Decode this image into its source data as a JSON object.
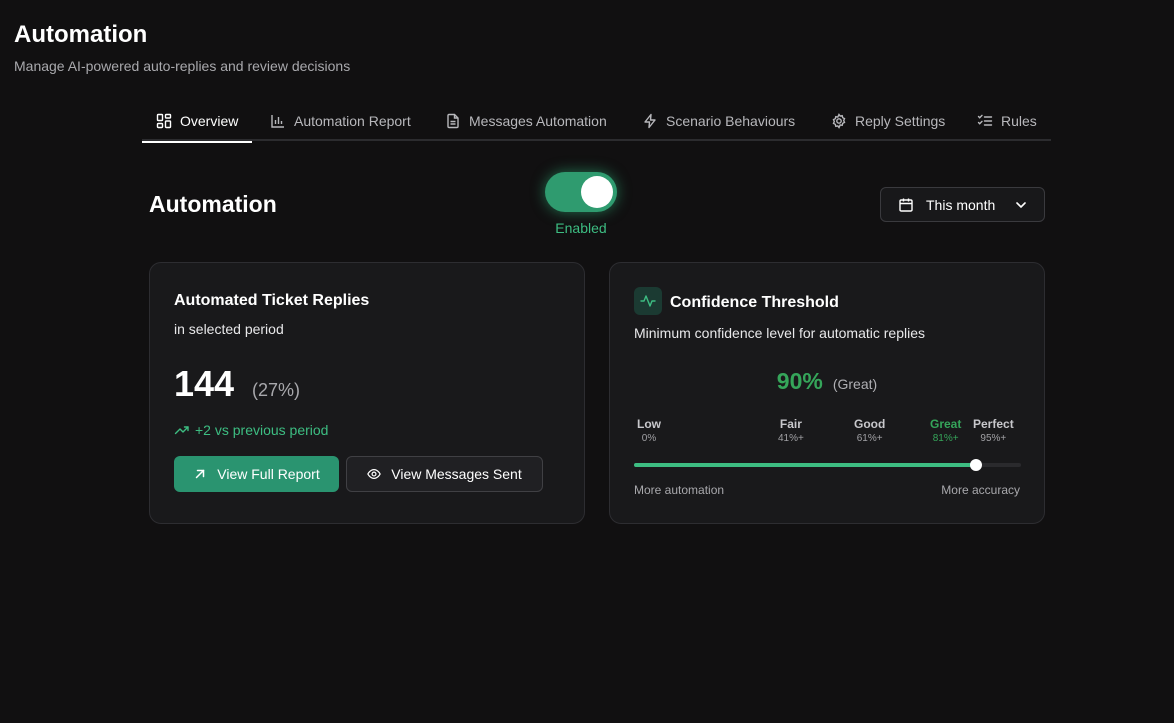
{
  "header": {
    "title": "Automation",
    "subtitle": "Manage AI-powered auto-replies and review decisions"
  },
  "tabs": [
    {
      "label": "Overview",
      "icon": "layout-grid-icon",
      "active": true
    },
    {
      "label": "Automation Report",
      "icon": "bar-chart-icon",
      "active": false
    },
    {
      "label": "Messages Automation",
      "icon": "document-icon",
      "active": false
    },
    {
      "label": "Scenario Behaviours",
      "icon": "lightning-icon",
      "active": false
    },
    {
      "label": "Reply Settings",
      "icon": "gear-icon",
      "active": false
    },
    {
      "label": "Rules",
      "icon": "checklist-icon",
      "active": false
    }
  ],
  "section": {
    "title": "Automation",
    "toggle": {
      "enabled": true,
      "label": "Enabled"
    },
    "period": {
      "label": "This month"
    }
  },
  "replies_card": {
    "title": "Automated Ticket Replies",
    "subtitle": "in selected period",
    "count": "144",
    "percent": "(27%)",
    "trend": "+2 vs previous period",
    "primary_button": "View Full Report",
    "secondary_button": "View Messages Sent"
  },
  "threshold_card": {
    "title": "Confidence Threshold",
    "subtitle": "Minimum confidence level for automatic replies",
    "value": "90%",
    "value_label": "(Great)",
    "slider_fraction": 0.885,
    "levels": [
      {
        "name": "Low",
        "value": "0%"
      },
      {
        "name": "Fair",
        "value": "41%+"
      },
      {
        "name": "Good",
        "value": "61%+"
      },
      {
        "name": "Great",
        "value": "81%+"
      },
      {
        "name": "Perfect",
        "value": "95%+"
      }
    ],
    "left_caption": "More automation",
    "right_caption": "More accuracy"
  },
  "colors": {
    "accent": "#3dbd82",
    "accent_dark": "#2a9470",
    "great": "#35a55a",
    "background": "#111011",
    "card": "#19191b"
  }
}
